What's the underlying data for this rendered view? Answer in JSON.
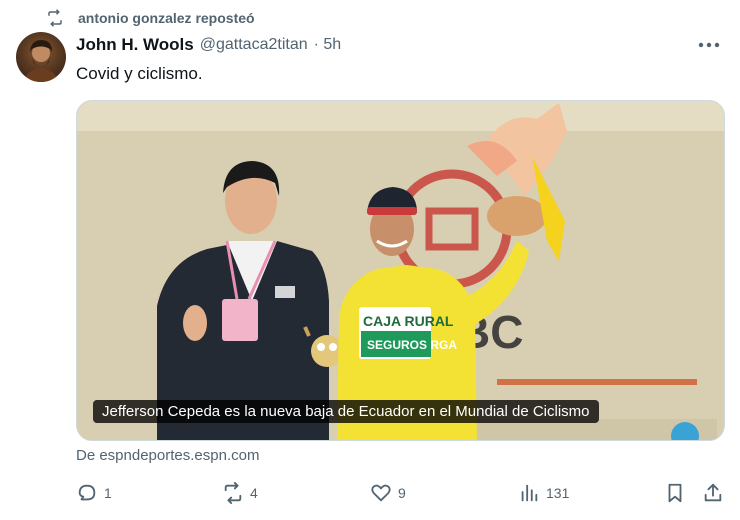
{
  "repost": {
    "label": "antonio gonzalez reposteó",
    "icon": "repost-icon"
  },
  "author": {
    "name": "John H. Wools",
    "handle": "@gattaca2titan",
    "time": "· 5h"
  },
  "tweet": {
    "text": "Covid y ciclismo."
  },
  "media": {
    "caption": "Jefferson Cepeda es la nueva baja de Ecuador en el Mundial de Ciclismo",
    "jersey_lines": [
      "CAJA RURAL",
      "SEGUROS RGA"
    ],
    "background_letters": "BC"
  },
  "source": {
    "text": "De espndeportes.espn.com"
  },
  "actions": {
    "reply_count": "1",
    "repost_count": "4",
    "like_count": "9",
    "views_count": "131"
  },
  "colors": {
    "text_primary": "#0f1419",
    "text_secondary": "#536471",
    "jersey_yellow": "#f3e234"
  }
}
